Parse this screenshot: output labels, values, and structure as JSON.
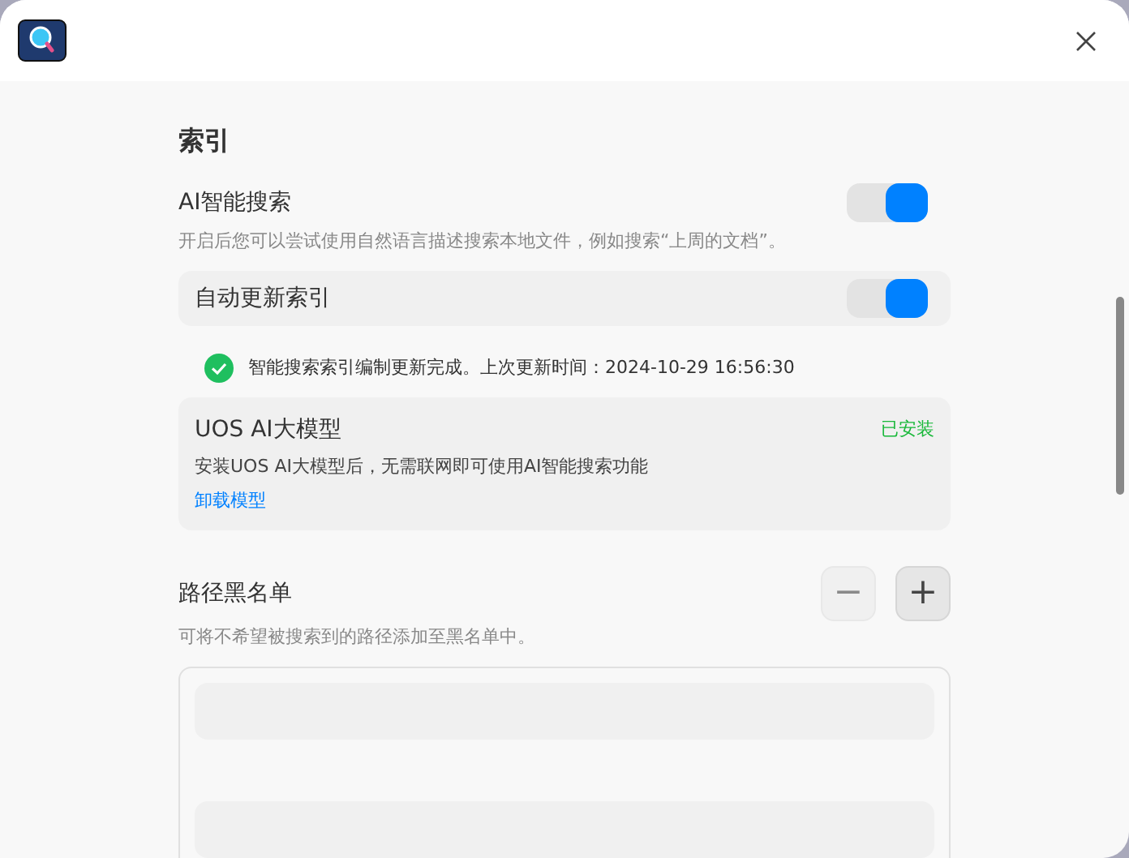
{
  "section_title": "索引",
  "ai_search": {
    "label": "AI智能搜索",
    "on": true,
    "description": "开启后您可以尝试使用自然语言描述搜索本地文件，例如搜索“上周的文档”。"
  },
  "auto_update": {
    "label": "自动更新索引",
    "on": true
  },
  "index_status": {
    "text": "智能搜索索引编制更新完成。上次更新时间：2024-10-29 16:56:30"
  },
  "model_card": {
    "title": "UOS AI大模型",
    "status": "已安装",
    "description": "安装UOS AI大模型后，无需联网即可使用AI智能搜索功能",
    "link": "卸载模型"
  },
  "blacklist": {
    "title": "路径黑名单",
    "description": "可将不希望被搜索到的路径添加至黑名单中。",
    "remove_button": {
      "label": "−",
      "disabled": true
    },
    "add_button": {
      "label": "+",
      "disabled": false
    }
  }
}
